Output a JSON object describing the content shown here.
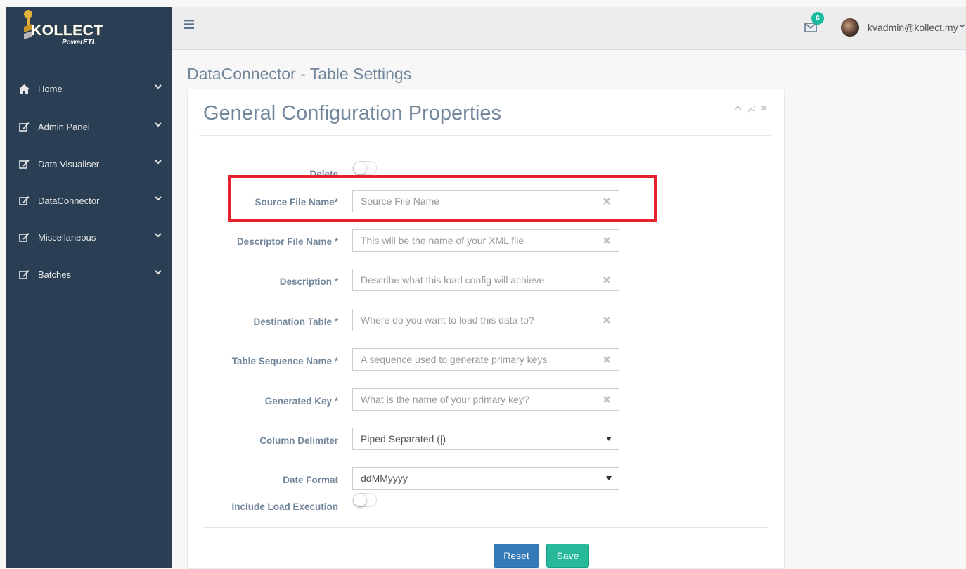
{
  "brand": {
    "name": "KOLLECT",
    "subtitle": "PowerETL"
  },
  "sidebar": {
    "items": [
      {
        "label": "Home",
        "icon": "home-icon"
      },
      {
        "label": "Admin Panel",
        "icon": "edit-icon"
      },
      {
        "label": "Data Visualiser",
        "icon": "edit-icon"
      },
      {
        "label": "DataConnector",
        "icon": "edit-icon"
      },
      {
        "label": "Miscellaneous",
        "icon": "edit-icon"
      },
      {
        "label": "Batches",
        "icon": "edit-icon"
      }
    ]
  },
  "topbar": {
    "notification_count": "6",
    "user_email": "kvadmin@kollect.my"
  },
  "page": {
    "title": "DataConnector - Table Settings"
  },
  "panel": {
    "title": "General Configuration Properties",
    "fields": {
      "delete_label": "Delete",
      "source_file_label": "Source File Name*",
      "source_file_placeholder": "Source File Name",
      "descriptor_label": "Descriptor File Name *",
      "descriptor_placeholder": "This will be the name of your XML file",
      "description_label": "Description *",
      "description_placeholder": "Describe what this load config will achieve",
      "destination_label": "Destination Table *",
      "destination_placeholder": "Where do you want to load this data to?",
      "sequence_label": "Table Sequence Name *",
      "sequence_placeholder": "A sequence used to generate primary keys",
      "generated_key_label": "Generated Key *",
      "generated_key_placeholder": "What is the name of your primary key?",
      "delimiter_label": "Column Delimiter",
      "delimiter_value": "Piped Separated (|)",
      "date_format_label": "Date Format",
      "date_format_value": "ddMMyyyy",
      "include_load_label": "Include Load Execution"
    },
    "buttons": {
      "reset": "Reset",
      "save": "Save"
    }
  },
  "colors": {
    "sidebar_bg": "#2a3f54",
    "accent_green": "#26b99a",
    "primary_blue": "#337ab7",
    "highlight_red": "#e8212e"
  }
}
